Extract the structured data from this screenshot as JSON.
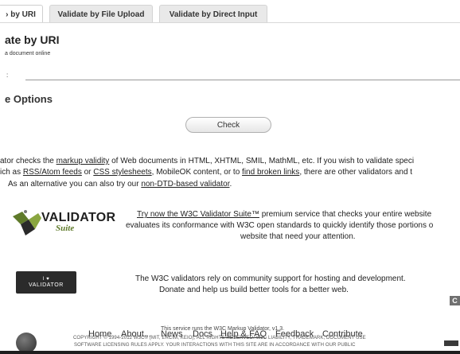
{
  "tabs": [
    {
      "label": "› by URI",
      "active": true
    },
    {
      "label": "Validate by File Upload",
      "active": false
    },
    {
      "label": "Validate by Direct Input",
      "active": false
    }
  ],
  "uri": {
    "title": "ate by URI",
    "subtitle": "a document online",
    "address_label": ":",
    "address_value": "",
    "more_options": "e Options",
    "check_label": "Check"
  },
  "info": {
    "line1_prefix": "ator checks the ",
    "line1_link": "markup validity",
    "line1_suffix": " of Web documents in HTML, XHTML, SMIL, MathML, etc. If you wish to validate speci",
    "line2_prefix": "ich as ",
    "line2_link1": "RSS/Atom feeds",
    "line2_mid1": " or ",
    "line2_link2": "CSS stylesheets",
    "line2_mid2": ", MobileOK content, or to ",
    "line2_link3": "find broken links",
    "line2_suffix": ", there are other validators and t",
    "line3_prefix": "As an alternative you can also try our ",
    "line3_link": "non-DTD-based validator",
    "line3_suffix": "."
  },
  "suite": {
    "logo_word": "VALIDATOR",
    "logo_sub": "Suite",
    "line1_link": "Try now the W3C Validator Suite™",
    "line1_suffix": " premium service that checks your entire website",
    "line2": "evaluates its conformance with W3C open standards to quickly identify those portions o",
    "line3": "website that need your attention."
  },
  "donate": {
    "badge_heart": "I ♥",
    "badge_text": "VALIDATOR",
    "line1": "The W3C validators rely on community support for hosting and development.",
    "line2": "Donate and help us build better tools for a better web."
  },
  "side_icon": "C",
  "footer": {
    "nav": [
      "Home",
      "About...",
      "News",
      "Docs",
      "Help & FAQ",
      "Feedback",
      "Contribute"
    ],
    "runs": "This service runs the W3C Markup Validator, v1.3.",
    "copyright1": "COPYRIGHT © 1994-2012 W3C® (MIT, ERCIM, KEIO), ALL RIGHTS RESERVED. W3C LIABILITY, TRADEMARK, DOCUMENT USE",
    "copyright2": "SOFTWARE LICENSING RULES APPLY. YOUR INTERACTIONS WITH THIS SITE ARE IN ACCORDANCE WITH OUR PUBLIC"
  }
}
